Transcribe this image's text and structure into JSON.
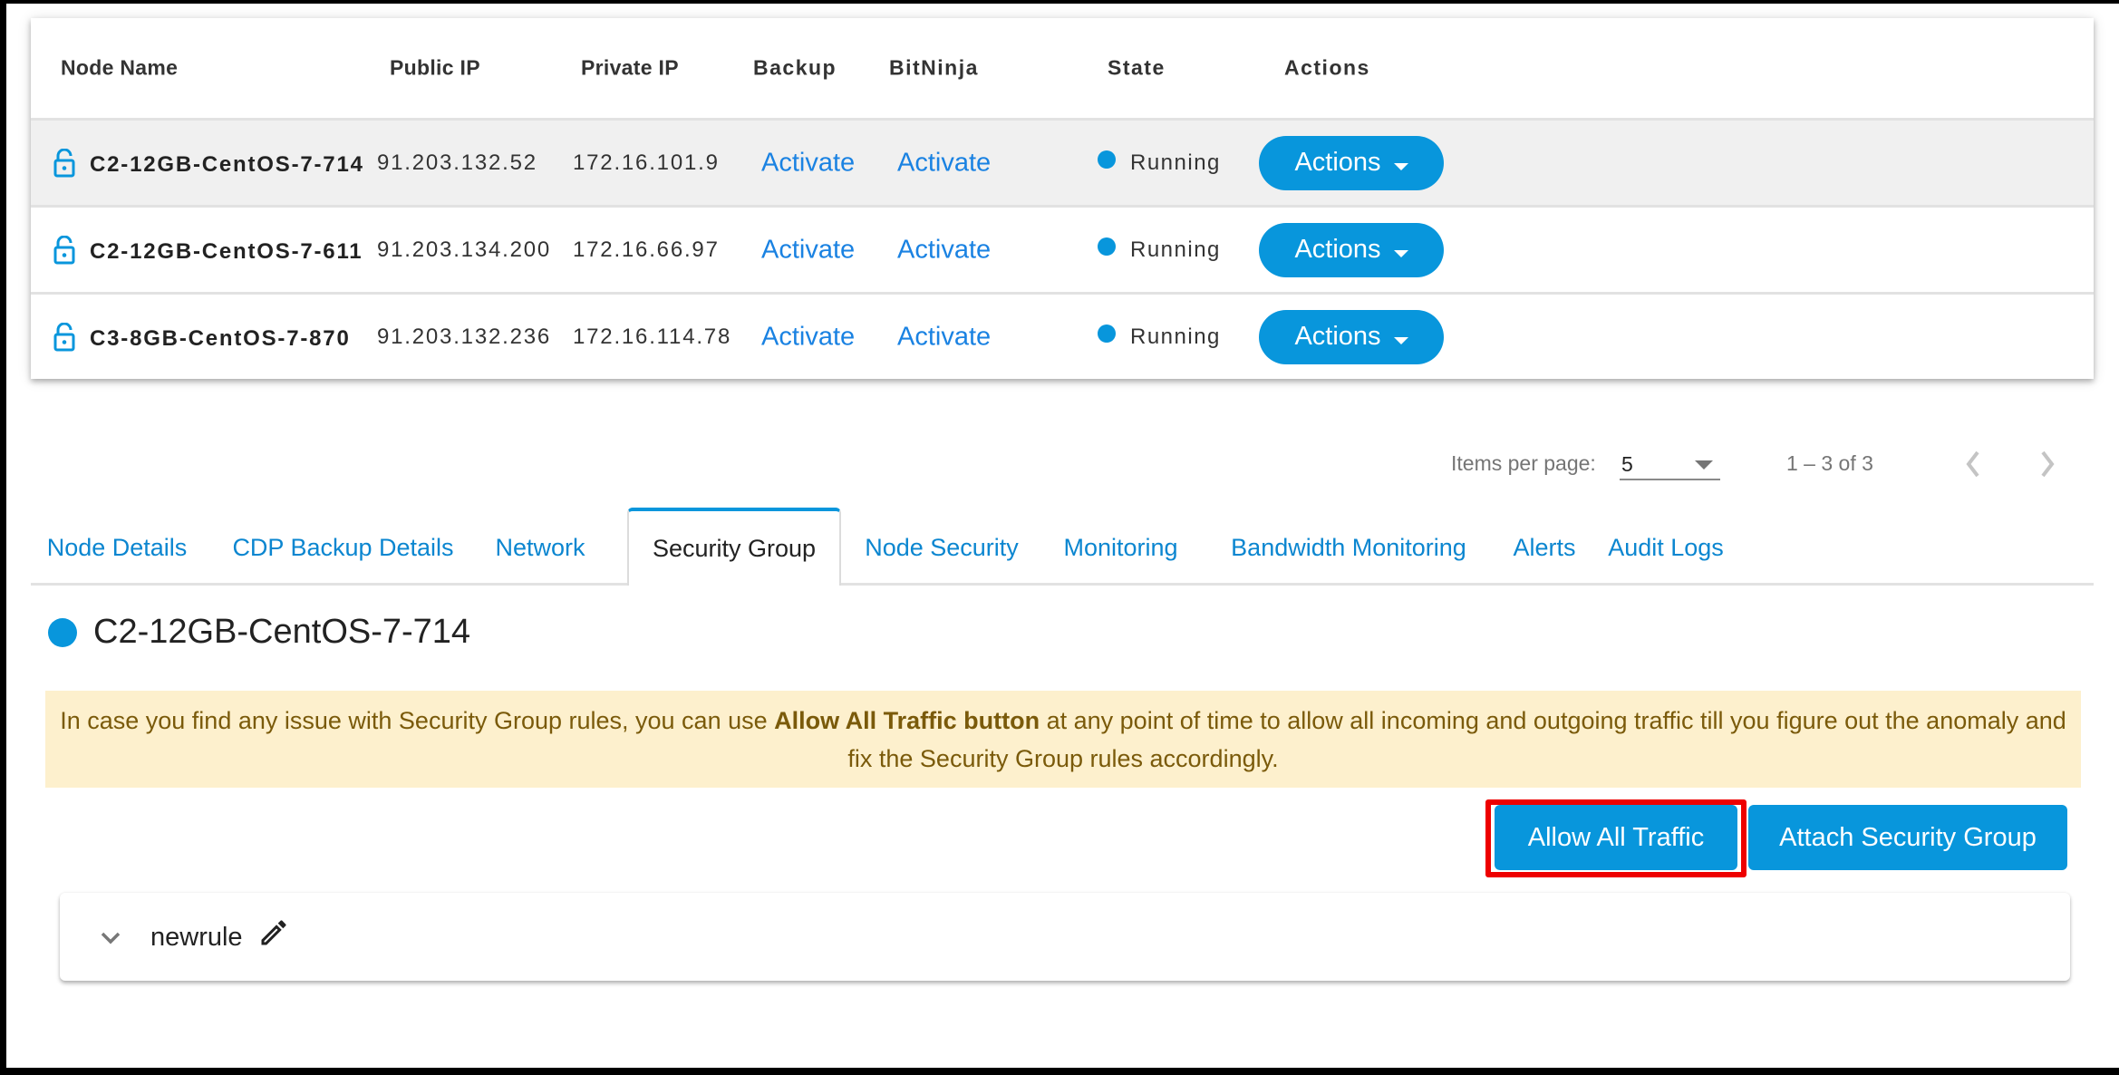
{
  "table": {
    "headers": {
      "node_name": "Node Name",
      "public_ip": "Public IP",
      "private_ip": "Private IP",
      "backup": "Backup",
      "bitninja": "BitNinja",
      "state": "State",
      "actions": "Actions"
    },
    "rows": [
      {
        "lock_icon": "unlock-icon",
        "node_name": "C2-12GB-CentOS-7-714",
        "public_ip": "91.203.132.52",
        "private_ip": "172.16.101.9",
        "backup": "Activate",
        "bitninja": "Activate",
        "state": "Running",
        "actions": "Actions"
      },
      {
        "lock_icon": "unlock-icon",
        "node_name": "C2-12GB-CentOS-7-611",
        "public_ip": "91.203.134.200",
        "private_ip": "172.16.66.97",
        "backup": "Activate",
        "bitninja": "Activate",
        "state": "Running",
        "actions": "Actions"
      },
      {
        "lock_icon": "unlock-icon",
        "node_name": "C3-8GB-CentOS-7-870",
        "public_ip": "91.203.132.236",
        "private_ip": "172.16.114.78",
        "backup": "Activate",
        "bitninja": "Activate",
        "state": "Running",
        "actions": "Actions"
      }
    ]
  },
  "paginator": {
    "items_per_page_label": "Items per page:",
    "items_per_page_value": "5",
    "range_label": "1 – 3 of 3"
  },
  "tabs": [
    {
      "label": "Node Details",
      "active": false
    },
    {
      "label": "CDP Backup Details",
      "active": false
    },
    {
      "label": "Network",
      "active": false
    },
    {
      "label": "Security Group",
      "active": true
    },
    {
      "label": "Node Security",
      "active": false
    },
    {
      "label": "Monitoring",
      "active": false
    },
    {
      "label": "Bandwidth Monitoring",
      "active": false
    },
    {
      "label": "Alerts",
      "active": false
    },
    {
      "label": "Audit Logs",
      "active": false
    }
  ],
  "detail": {
    "node_title": "C2-12GB-CentOS-7-714",
    "notice": {
      "before": "In case you find any issue with Security Group rules, you can use ",
      "bold": "Allow All Traffic button",
      "after": " at any point of time to allow all incoming and outgoing traffic till you figure out the anomaly and fix the Security Group rules accordingly."
    },
    "buttons": {
      "allow_all_traffic": "Allow All Traffic",
      "attach_security_group": "Attach Security Group"
    },
    "security_groups": [
      {
        "name": "newrule"
      }
    ]
  },
  "colors": {
    "primary": "#0896dc",
    "link": "#1a82e2",
    "notice_bg": "#fdf0cd",
    "notice_text": "#7a5a0a",
    "highlight": "#ee0000"
  }
}
